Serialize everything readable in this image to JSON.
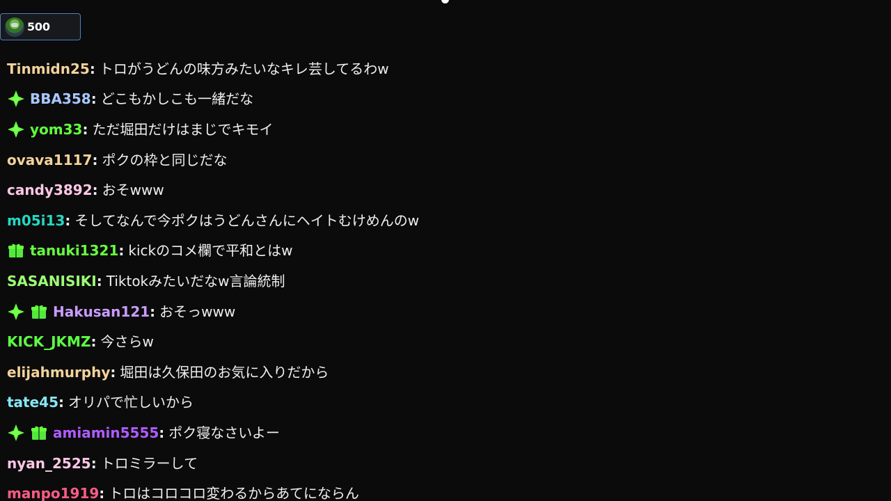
{
  "points": {
    "value": "500",
    "avatar_icon": "green-avatar-icon"
  },
  "chat": {
    "messages": [
      {
        "user": "Tinmidn25",
        "color": "#f3d39a",
        "badges": [],
        "text": "トロがうどんの味方みたいなキレ芸してるわw"
      },
      {
        "user": "BBA358",
        "color": "#a8c8ff",
        "badges": [
          "sparkle"
        ],
        "text": "どこもかしこも一緒だな"
      },
      {
        "user": "yom33",
        "color": "#60ff3c",
        "badges": [
          "sparkle"
        ],
        "text": "ただ堀田だけはまじでキモイ"
      },
      {
        "user": "ovava1117",
        "color": "#f3d39a",
        "badges": [],
        "text": "ポクの枠と同じだな"
      },
      {
        "user": "candy3892",
        "color": "#ffc7e6",
        "badges": [],
        "text": "おそwww"
      },
      {
        "user": "m05i13",
        "color": "#23d9c1",
        "badges": [],
        "text": "そしてなんで今ポクはうどんさんにヘイトむけめんのw"
      },
      {
        "user": "tanuki1321",
        "color": "#66ff40",
        "badges": [
          "gift"
        ],
        "text": "kickのコメ欄で平和とはw"
      },
      {
        "user": "SASANISIKI",
        "color": "#9dff76",
        "badges": [],
        "text": "Tiktokみたいだなw言論統制"
      },
      {
        "user": "Hakusan121",
        "color": "#c99cff",
        "badges": [
          "sparkle",
          "gift"
        ],
        "text": "おそっwww"
      },
      {
        "user": "KICK_JKMZ",
        "color": "#5dff44",
        "badges": [],
        "text": "今さらw"
      },
      {
        "user": "elijahmurphy",
        "color": "#f3d39a",
        "badges": [],
        "text": "堀田は久保田のお気に入りだから"
      },
      {
        "user": "tate45",
        "color": "#86e7f5",
        "badges": [],
        "text": "オリパで忙しいから"
      },
      {
        "user": "amiamin5555",
        "color": "#b05cff",
        "badges": [
          "sparkle",
          "gift"
        ],
        "text": "ポク寝なさいよー"
      },
      {
        "user": "nyan_2525",
        "color": "#ffc7e6",
        "badges": [],
        "text": "トロミラーして"
      },
      {
        "user": "manpo1919",
        "color": "#ff5c85",
        "badges": [],
        "text": "トロはコロコロ変わるからあてにならん"
      }
    ]
  }
}
